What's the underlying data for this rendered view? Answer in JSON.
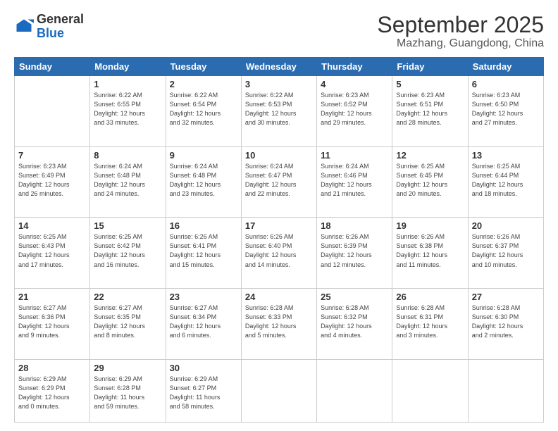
{
  "logo": {
    "line1": "General",
    "line2": "Blue"
  },
  "header": {
    "month": "September 2025",
    "location": "Mazhang, Guangdong, China"
  },
  "weekdays": [
    "Sunday",
    "Monday",
    "Tuesday",
    "Wednesday",
    "Thursday",
    "Friday",
    "Saturday"
  ],
  "weeks": [
    [
      {
        "day": "",
        "info": ""
      },
      {
        "day": "1",
        "info": "Sunrise: 6:22 AM\nSunset: 6:55 PM\nDaylight: 12 hours\nand 33 minutes."
      },
      {
        "day": "2",
        "info": "Sunrise: 6:22 AM\nSunset: 6:54 PM\nDaylight: 12 hours\nand 32 minutes."
      },
      {
        "day": "3",
        "info": "Sunrise: 6:22 AM\nSunset: 6:53 PM\nDaylight: 12 hours\nand 30 minutes."
      },
      {
        "day": "4",
        "info": "Sunrise: 6:23 AM\nSunset: 6:52 PM\nDaylight: 12 hours\nand 29 minutes."
      },
      {
        "day": "5",
        "info": "Sunrise: 6:23 AM\nSunset: 6:51 PM\nDaylight: 12 hours\nand 28 minutes."
      },
      {
        "day": "6",
        "info": "Sunrise: 6:23 AM\nSunset: 6:50 PM\nDaylight: 12 hours\nand 27 minutes."
      }
    ],
    [
      {
        "day": "7",
        "info": "Sunrise: 6:23 AM\nSunset: 6:49 PM\nDaylight: 12 hours\nand 26 minutes."
      },
      {
        "day": "8",
        "info": "Sunrise: 6:24 AM\nSunset: 6:48 PM\nDaylight: 12 hours\nand 24 minutes."
      },
      {
        "day": "9",
        "info": "Sunrise: 6:24 AM\nSunset: 6:48 PM\nDaylight: 12 hours\nand 23 minutes."
      },
      {
        "day": "10",
        "info": "Sunrise: 6:24 AM\nSunset: 6:47 PM\nDaylight: 12 hours\nand 22 minutes."
      },
      {
        "day": "11",
        "info": "Sunrise: 6:24 AM\nSunset: 6:46 PM\nDaylight: 12 hours\nand 21 minutes."
      },
      {
        "day": "12",
        "info": "Sunrise: 6:25 AM\nSunset: 6:45 PM\nDaylight: 12 hours\nand 20 minutes."
      },
      {
        "day": "13",
        "info": "Sunrise: 6:25 AM\nSunset: 6:44 PM\nDaylight: 12 hours\nand 18 minutes."
      }
    ],
    [
      {
        "day": "14",
        "info": "Sunrise: 6:25 AM\nSunset: 6:43 PM\nDaylight: 12 hours\nand 17 minutes."
      },
      {
        "day": "15",
        "info": "Sunrise: 6:25 AM\nSunset: 6:42 PM\nDaylight: 12 hours\nand 16 minutes."
      },
      {
        "day": "16",
        "info": "Sunrise: 6:26 AM\nSunset: 6:41 PM\nDaylight: 12 hours\nand 15 minutes."
      },
      {
        "day": "17",
        "info": "Sunrise: 6:26 AM\nSunset: 6:40 PM\nDaylight: 12 hours\nand 14 minutes."
      },
      {
        "day": "18",
        "info": "Sunrise: 6:26 AM\nSunset: 6:39 PM\nDaylight: 12 hours\nand 12 minutes."
      },
      {
        "day": "19",
        "info": "Sunrise: 6:26 AM\nSunset: 6:38 PM\nDaylight: 12 hours\nand 11 minutes."
      },
      {
        "day": "20",
        "info": "Sunrise: 6:26 AM\nSunset: 6:37 PM\nDaylight: 12 hours\nand 10 minutes."
      }
    ],
    [
      {
        "day": "21",
        "info": "Sunrise: 6:27 AM\nSunset: 6:36 PM\nDaylight: 12 hours\nand 9 minutes."
      },
      {
        "day": "22",
        "info": "Sunrise: 6:27 AM\nSunset: 6:35 PM\nDaylight: 12 hours\nand 8 minutes."
      },
      {
        "day": "23",
        "info": "Sunrise: 6:27 AM\nSunset: 6:34 PM\nDaylight: 12 hours\nand 6 minutes."
      },
      {
        "day": "24",
        "info": "Sunrise: 6:28 AM\nSunset: 6:33 PM\nDaylight: 12 hours\nand 5 minutes."
      },
      {
        "day": "25",
        "info": "Sunrise: 6:28 AM\nSunset: 6:32 PM\nDaylight: 12 hours\nand 4 minutes."
      },
      {
        "day": "26",
        "info": "Sunrise: 6:28 AM\nSunset: 6:31 PM\nDaylight: 12 hours\nand 3 minutes."
      },
      {
        "day": "27",
        "info": "Sunrise: 6:28 AM\nSunset: 6:30 PM\nDaylight: 12 hours\nand 2 minutes."
      }
    ],
    [
      {
        "day": "28",
        "info": "Sunrise: 6:29 AM\nSunset: 6:29 PM\nDaylight: 12 hours\nand 0 minutes."
      },
      {
        "day": "29",
        "info": "Sunrise: 6:29 AM\nSunset: 6:28 PM\nDaylight: 11 hours\nand 59 minutes."
      },
      {
        "day": "30",
        "info": "Sunrise: 6:29 AM\nSunset: 6:27 PM\nDaylight: 11 hours\nand 58 minutes."
      },
      {
        "day": "",
        "info": ""
      },
      {
        "day": "",
        "info": ""
      },
      {
        "day": "",
        "info": ""
      },
      {
        "day": "",
        "info": ""
      }
    ]
  ]
}
